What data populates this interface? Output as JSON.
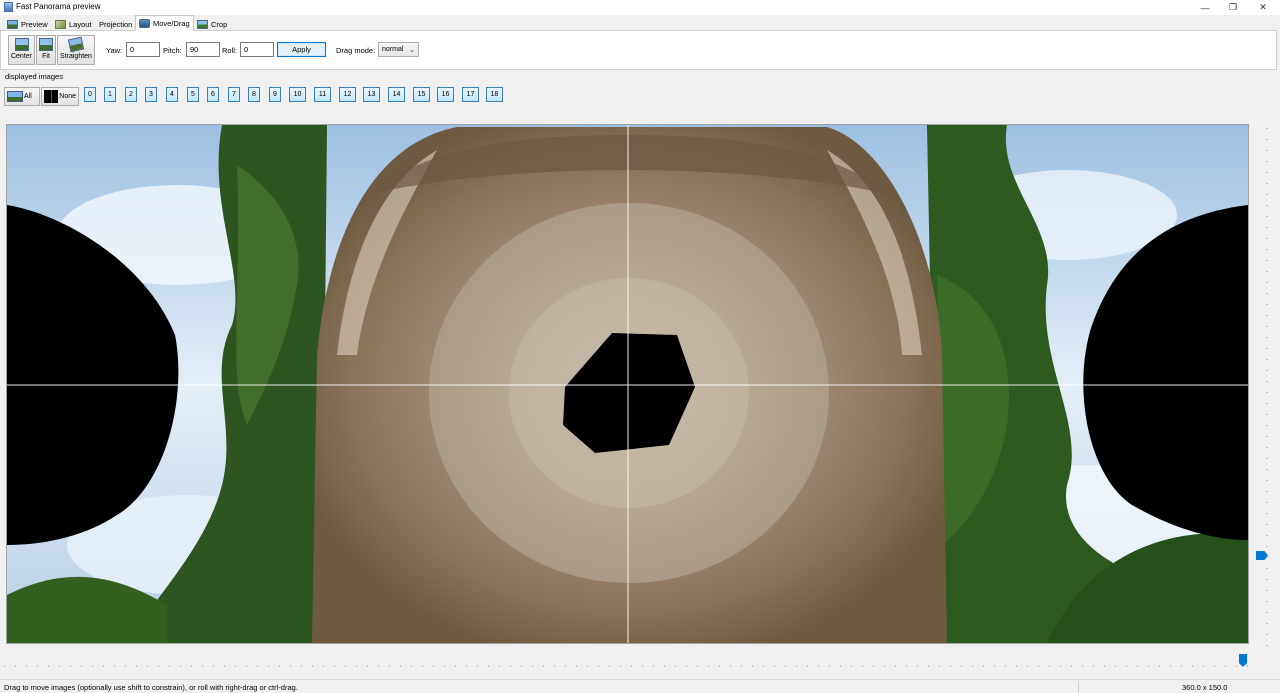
{
  "window": {
    "title": "Fast Panorama preview",
    "minimize_icon": "minimize-icon",
    "restore_icon": "restore-icon",
    "close_icon": "close-icon"
  },
  "tabs": [
    {
      "label": "Preview",
      "icon": "preview-icon"
    },
    {
      "label": "Layout",
      "icon": "layout-icon"
    },
    {
      "label": "Projection",
      "icon": ""
    },
    {
      "label": "Move/Drag",
      "icon": "move-drag-icon",
      "active": true
    },
    {
      "label": "Crop",
      "icon": "crop-icon"
    }
  ],
  "toolbar": {
    "center_label": "Center",
    "fit_label": "Fit",
    "straighten_label": "Straighten",
    "yaw_label": "Yaw:",
    "yaw_value": "0",
    "pitch_label": "Pitch:",
    "pitch_value": "90",
    "roll_label": "Roll:",
    "roll_value": "0",
    "apply_label": "Apply",
    "drag_mode_label": "Drag mode:",
    "drag_mode_value": "normal"
  },
  "displayed_images": {
    "label": "displayed images",
    "all_label": "All",
    "none_label": "None",
    "images": [
      "0",
      "1",
      "2",
      "3",
      "4",
      "5",
      "6",
      "7",
      "8",
      "9",
      "10",
      "11",
      "12",
      "13",
      "14",
      "15",
      "16",
      "17",
      "18"
    ]
  },
  "status": {
    "message": "Drag to move images (optionally use shift to constrain), or roll with right-drag or ctrl-drag.",
    "fov": "360.0 x 150.0"
  },
  "colors": {
    "accent": "#0078d7",
    "sky": "#b9d3ea",
    "foliage": "#2f5a1f",
    "ground": "#8a7a63"
  }
}
